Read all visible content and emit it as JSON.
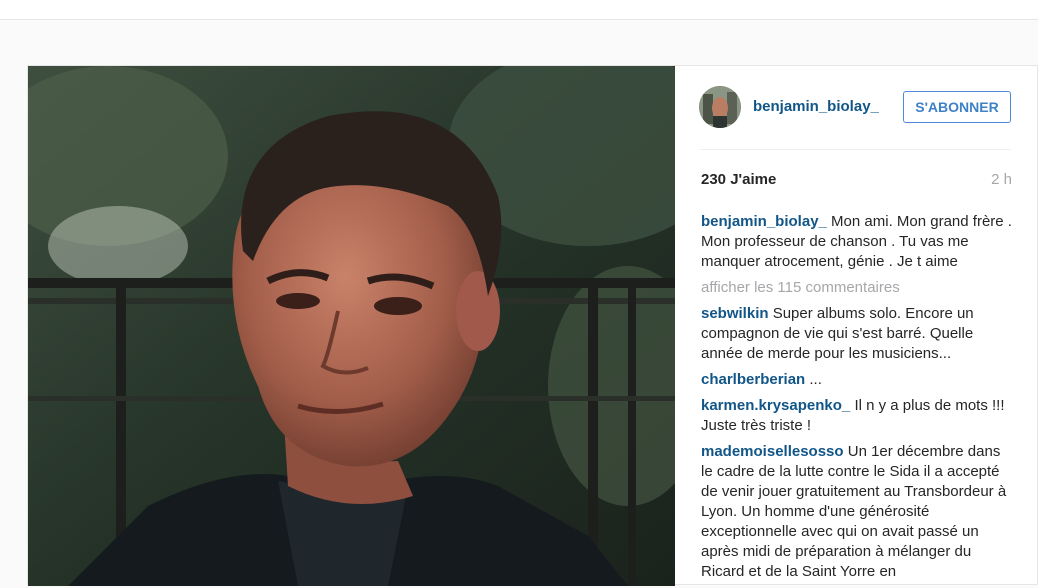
{
  "post": {
    "username": "benjamin_biolay_",
    "follow_label": "S'ABONNER",
    "likes": "230 J'aime",
    "time": "2 h",
    "show_more": "afficher les 115 commentaires",
    "caption": {
      "author": "benjamin_biolay_",
      "text": "Mon ami. Mon grand frère . Mon professeur de chanson . Tu vas me manquer atrocement, génie . Je t aime"
    },
    "comments": [
      {
        "author": "sebwilkin",
        "text": "Super albums solo. Encore un compagnon de vie qui s'est barré. Quelle année de merde pour les musiciens..."
      },
      {
        "author": "charlberberian",
        "text": "..."
      },
      {
        "author": "karmen.krysapenko_",
        "text": "Il n y a plus de mots !!! Juste très triste !"
      },
      {
        "author": "mademoisellesosso",
        "text": "Un 1er décembre dans le cadre de la lutte contre le Sida il a accepté de venir jouer gratuitement au Transbordeur à Lyon. Un homme d'une générosité exceptionnelle avec qui on avait passé un après midi de préparation à mélanger du Ricard et de la Saint Yorre en"
      }
    ]
  },
  "colors": {
    "username": "#125688",
    "follow_border": "#4f8ad8",
    "muted": "#a5a7aa"
  }
}
